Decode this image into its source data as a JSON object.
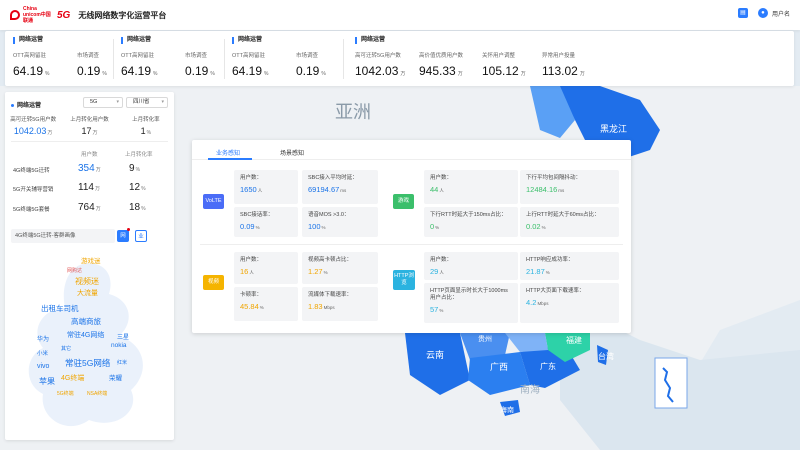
{
  "header": {
    "logo_text": "China unicom中国联通",
    "logo_5g": "5G",
    "title": "无线网络数字化运营平台",
    "user_name": "用户名"
  },
  "kpi_groups": [
    {
      "title": "网络运营",
      "items": [
        {
          "label": "OTT高网留驻",
          "value": "64.19",
          "unit": "%"
        },
        {
          "label": "市场调查",
          "value": "0.19",
          "unit": "%"
        }
      ]
    },
    {
      "title": "网络运营",
      "items": [
        {
          "label": "OTT高网留驻",
          "value": "64.19",
          "unit": "%"
        },
        {
          "label": "市场调查",
          "value": "0.19",
          "unit": "%"
        }
      ]
    },
    {
      "title": "网络运营",
      "items": [
        {
          "label": "OTT高网留驻",
          "value": "64.19",
          "unit": "%"
        },
        {
          "label": "市场调查",
          "value": "0.19",
          "unit": "%"
        }
      ]
    },
    {
      "title": "网络运营",
      "items": [
        {
          "label": "高可迁转5G用户数",
          "value": "1042.03",
          "unit": "万"
        },
        {
          "label": "高价值优质用户数",
          "value": "945.33",
          "unit": "万"
        },
        {
          "label": "关怀用户调整",
          "value": "105.12",
          "unit": "万"
        },
        {
          "label": "异常用户投量",
          "value": "113.02",
          "unit": "万"
        }
      ]
    }
  ],
  "left_panel": {
    "title": "网络运营",
    "select_network": "5G",
    "select_region": "四川省",
    "stats": [
      {
        "label": "高可迁转5G用户数",
        "value": "1042.03",
        "unit": "万"
      },
      {
        "label": "上月转化用户数",
        "value": "17",
        "unit": "万"
      },
      {
        "label": "上月转化率",
        "value": "1",
        "unit": "%"
      }
    ],
    "col_headers": [
      "用户数",
      "上月转化率"
    ],
    "rows": [
      {
        "label": "4G终端5G迁转",
        "a": "354",
        "a_unit": "万",
        "b": "9",
        "b_unit": "%"
      },
      {
        "label": "5G开关辅导营销",
        "a": "114",
        "a_unit": "万",
        "b": "12",
        "b_unit": "%"
      },
      {
        "label": "5G终端5G套餐",
        "a": "764",
        "a_unit": "万",
        "b": "18",
        "b_unit": "%"
      }
    ],
    "search_text": "4G终端5G迁转-客群画像",
    "btn_primary": "网",
    "btn_secondary": "业",
    "word_cloud": [
      {
        "text": "游戏迷",
        "color": "#f0a500",
        "size": 6.5
      },
      {
        "text": "网购达",
        "color": "#e05050",
        "size": 5
      },
      {
        "text": "视频迷",
        "color": "#f0a500",
        "size": 8
      },
      {
        "text": "大流量",
        "color": "#f0a500",
        "size": 7
      },
      {
        "text": "出租车司机",
        "color": "#1a73e8",
        "size": 7.5
      },
      {
        "text": "高端商旅",
        "color": "#1a73e8",
        "size": 7.5
      },
      {
        "text": "常驻4G网络",
        "color": "#1a73e8",
        "size": 7
      },
      {
        "text": "华为",
        "color": "#1a73e8",
        "size": 6
      },
      {
        "text": "三星",
        "color": "#1a73e8",
        "size": 6
      },
      {
        "text": "nokia",
        "color": "#1a73e8",
        "size": 6.5
      },
      {
        "text": "小米",
        "color": "#1a73e8",
        "size": 5.5
      },
      {
        "text": "其它",
        "color": "#1a73e8",
        "size": 5
      },
      {
        "text": "常驻5G网络",
        "color": "#1a73e8",
        "size": 8.5
      },
      {
        "text": "红米",
        "color": "#1a73e8",
        "size": 5
      },
      {
        "text": "vivo",
        "color": "#1a73e8",
        "size": 7
      },
      {
        "text": "荣耀",
        "color": "#1a73e8",
        "size": 6.5
      },
      {
        "text": "苹果",
        "color": "#1a73e8",
        "size": 8
      },
      {
        "text": "4G终端",
        "color": "#f0a500",
        "size": 7
      },
      {
        "text": "5G终端",
        "color": "#f0a500",
        "size": 5
      },
      {
        "text": "NSA终端",
        "color": "#f0a500",
        "size": 5
      }
    ]
  },
  "center_panel": {
    "tabs": [
      "业务感知",
      "场景感知"
    ],
    "sections": [
      {
        "badge": "VoLTE",
        "badge_color": "#4a6cf7",
        "cells": [
          {
            "label": "用户数：",
            "value": "1650",
            "unit": "人",
            "color": "blue"
          },
          {
            "label": "SBC接入平均时延：",
            "value": "69194.67",
            "unit": "ms",
            "color": "blue"
          },
          {
            "label": "SBC接话率：",
            "value": "0.09",
            "unit": "%",
            "color": "blue"
          },
          {
            "label": "语音MOS >3.0：",
            "value": "100",
            "unit": "%",
            "color": "blue"
          }
        ]
      },
      {
        "badge": "游戏",
        "badge_color": "#3bbf6b",
        "cells": [
          {
            "label": "用户数：",
            "value": "44",
            "unit": "人",
            "color": "green"
          },
          {
            "label": "下行平均包间隔抖动：",
            "value": "12484.16",
            "unit": "ms",
            "color": "green"
          },
          {
            "label": "下行RTT时延大于150ms占比：",
            "value": "0",
            "unit": "%",
            "color": "green"
          },
          {
            "label": "上行RTT时延大于60ms占比：",
            "value": "0.02",
            "unit": "%",
            "color": "green"
          }
        ]
      },
      {
        "badge": "视频",
        "badge_color": "#f5b400",
        "cells": [
          {
            "label": "用户数：",
            "value": "16",
            "unit": "人",
            "color": "orange"
          },
          {
            "label": "视频高卡顿占比：",
            "value": "1.27",
            "unit": "%",
            "color": "orange"
          },
          {
            "label": "卡顿率：",
            "value": "45.84",
            "unit": "%",
            "color": "orange"
          },
          {
            "label": "流媒体下载速率：",
            "value": "1.83",
            "unit": "Mbps",
            "color": "orange"
          }
        ]
      },
      {
        "badge": "HTTP浏览",
        "badge_color": "#2bb3e0",
        "cells": [
          {
            "label": "用户数：",
            "value": "29",
            "unit": "人",
            "color": "cyan"
          },
          {
            "label": "HTTP响应成功率：",
            "value": "21.87",
            "unit": "%",
            "color": "cyan"
          },
          {
            "label": "HTTP页面显示时长大于1000ms用户占比：",
            "value": "57",
            "unit": "%",
            "color": "cyan"
          },
          {
            "label": "HTTP大页面下载速率：",
            "value": "4.2",
            "unit": "Mbps",
            "color": "cyan"
          }
        ]
      }
    ]
  },
  "map": {
    "continent_label": "亚洲",
    "provinces": [
      "黑龙江",
      "贵州",
      "云南",
      "广西",
      "广东",
      "福建",
      "台湾",
      "海南"
    ],
    "ocean_label": "南海"
  }
}
